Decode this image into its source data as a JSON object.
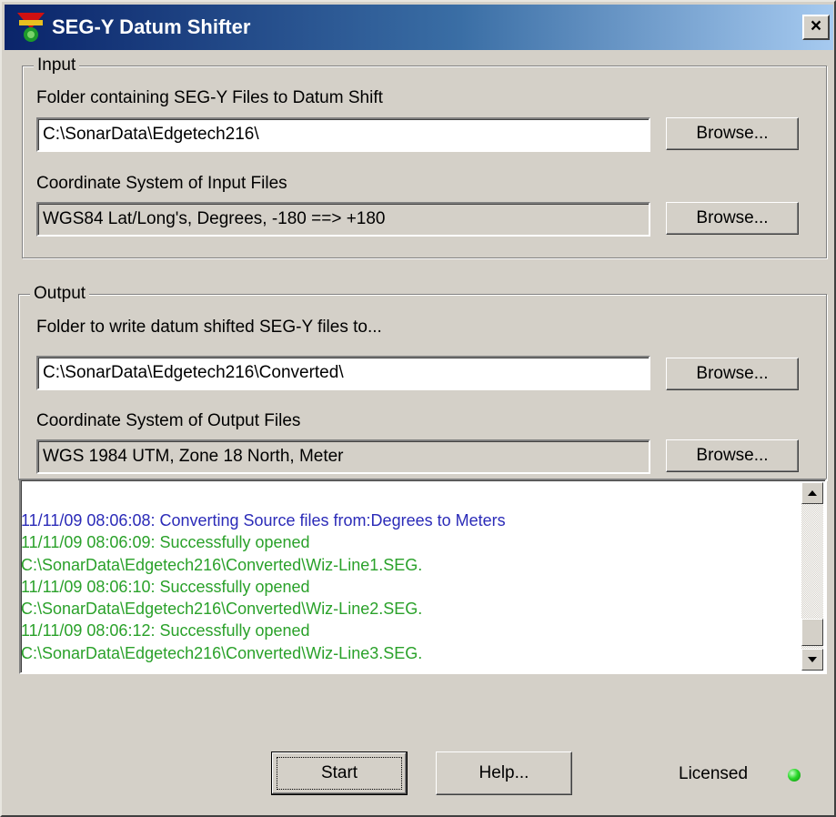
{
  "window": {
    "title": "SEG-Y Datum Shifter",
    "close_label": "×",
    "icon": "app-logo-icon"
  },
  "input_group": {
    "legend": "Input",
    "folder_label": "Folder containing SEG-Y Files to Datum Shift",
    "folder_value": "C:\\SonarData\\Edgetech216\\",
    "folder_browse": "Browse...",
    "cs_label": "Coordinate System of Input Files",
    "cs_value": "WGS84 Lat/Long's, Degrees, -180 ==> +180",
    "cs_browse": "Browse..."
  },
  "output_group": {
    "legend": "Output",
    "folder_label": "Folder to write datum shifted SEG-Y files to...",
    "folder_value": "C:\\SonarData\\Edgetech216\\Converted\\",
    "folder_browse": "Browse...",
    "cs_label": "Coordinate System of Output Files",
    "cs_value": "WGS 1984 UTM, Zone 18 North, Meter",
    "cs_browse": "Browse..."
  },
  "log": {
    "lines": [
      {
        "text": "11/11/09 08:06:08: Converting Source files from:Degrees to Meters",
        "color": "#2b2bb8"
      },
      {
        "text": "11/11/09 08:06:09: Successfully opened",
        "color": "#2aa12a"
      },
      {
        "text": "C:\\SonarData\\Edgetech216\\Converted\\Wiz-Line1.SEG.",
        "color": "#2aa12a"
      },
      {
        "text": "11/11/09 08:06:10: Successfully opened",
        "color": "#2aa12a"
      },
      {
        "text": "C:\\SonarData\\Edgetech216\\Converted\\Wiz-Line2.SEG.",
        "color": "#2aa12a"
      },
      {
        "text": "11/11/09 08:06:12: Successfully opened",
        "color": "#2aa12a"
      },
      {
        "text": "C:\\SonarData\\Edgetech216\\Converted\\Wiz-Line3.SEG.",
        "color": "#2aa12a"
      }
    ]
  },
  "buttons": {
    "start": "Start",
    "help": "Help..."
  },
  "status": {
    "licensed_label": "Licensed",
    "indicator_color": "#2bd92b"
  }
}
